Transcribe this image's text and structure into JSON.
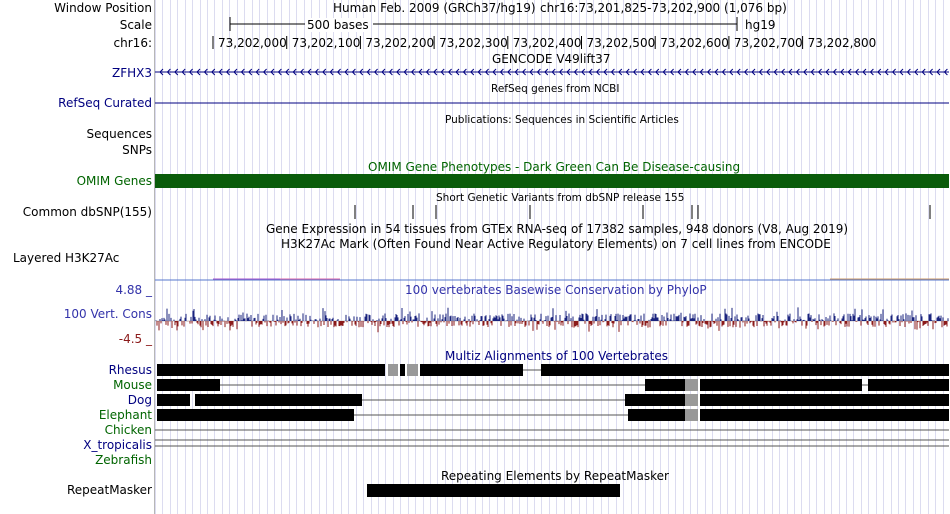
{
  "header": {
    "window_position_label": "Window Position",
    "assembly": "Human Feb. 2009 (GRCh37/hg19)",
    "region": "chr16:73,201,825-73,202,900 (1,076 bp)",
    "scale_label": "Scale",
    "scale_text": "500 bases",
    "genome": "hg19",
    "chrom_label": "chr16:",
    "ruler_ticks": [
      "73,202,000",
      "73,202,100",
      "73,202,200",
      "73,202,300",
      "73,202,400",
      "73,202,500",
      "73,202,600",
      "73,202,700",
      "73,202,800"
    ]
  },
  "tracks": {
    "gencode": {
      "title": "GENCODE V49lift37",
      "gene": "ZFHX3"
    },
    "refseq": {
      "label": "RefSeq Curated",
      "title": "RefSeq genes from NCBI"
    },
    "publications": {
      "label_1": "Sequences",
      "label_2": "SNPs",
      "title": "Publications: Sequences in Scientific Articles"
    },
    "omim": {
      "label": "OMIM Genes",
      "title": "OMIM Gene Phenotypes - Dark Green Can Be Disease-causing",
      "color": "#0a5c0a"
    },
    "dbsnp": {
      "label": "Common dbSNP(155)",
      "title": "Short Genetic Variants from dbSNP release 155"
    },
    "gtex": {
      "title": "Gene Expression in 54 tissues from GTEx RNA-seq of 17382 samples, 948 donors (V8, Aug 2019)"
    },
    "h3k27ac": {
      "label": "Layered H3K27Ac",
      "title": "H3K27Ac Mark (Often Found Near Active Regulatory Elements) on 7 cell lines from ENCODE"
    },
    "phylop": {
      "label": "100 Vert. Cons",
      "max": "4.88 _",
      "min": "-4.5 _",
      "title": "100 vertebrates Basewise Conservation by PhyloP",
      "pos_color": "#1a237e",
      "neg_color": "#8b1a1a"
    },
    "multiz": {
      "title": "Multiz Alignments of 100 Vertebrates",
      "species": [
        {
          "name": "Rhesus",
          "color": "#000080"
        },
        {
          "name": "Mouse",
          "color": "#006400"
        },
        {
          "name": "Dog",
          "color": "#000080"
        },
        {
          "name": "Elephant",
          "color": "#006400"
        },
        {
          "name": "Chicken",
          "color": "#006400"
        },
        {
          "name": "X_tropicalis",
          "color": "#000080"
        },
        {
          "name": "Zebrafish",
          "color": "#006400"
        }
      ]
    },
    "repeatmasker": {
      "label": "RepeatMasker",
      "title": "Repeating Elements by RepeatMasker"
    }
  }
}
